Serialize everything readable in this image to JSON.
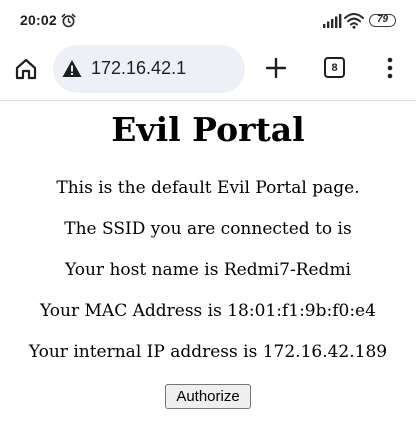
{
  "status_bar": {
    "time": "20:02",
    "battery_level": "79",
    "icons": [
      "alarm-icon",
      "signal-icon",
      "wifi-icon",
      "battery-icon"
    ]
  },
  "browser": {
    "url": "172.16.42.1",
    "tab_count": "8",
    "security_icon": "warning-icon",
    "buttons": [
      "home-icon",
      "plus-icon",
      "tabs-icon",
      "more-vertical-icon"
    ]
  },
  "page": {
    "title": "Evil Portal",
    "line_default": "This is the default Evil Portal page.",
    "line_ssid": "The SSID you are connected to is",
    "line_host": "Your host name is Redmi7-Redmi",
    "line_mac": "Your MAC Address is 18:01:f1:9b:f0:e4",
    "line_ip": "Your internal IP address is 172.16.42.189",
    "authorize_label": "Authorize"
  }
}
